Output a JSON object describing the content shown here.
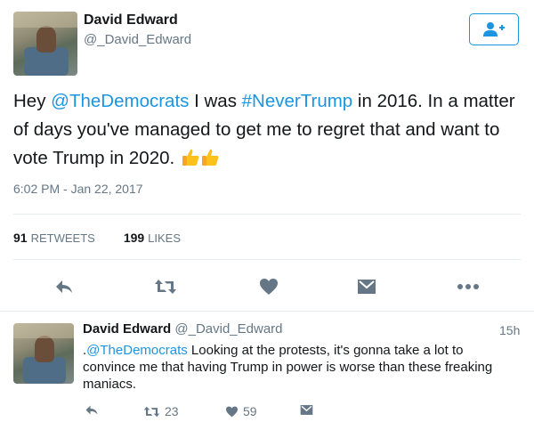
{
  "author": {
    "name": "David Edward",
    "handle": "@_David_Edward"
  },
  "tweet": {
    "text_before_mention": "Hey ",
    "mention": "@TheDemocrats",
    "text_middle": " I was ",
    "hashtag": "#NeverTrump",
    "text_after": " in 2016. In a matter of days you've managed to get me to regret that and want to vote Trump in 2020. ",
    "emoji": "👍👍",
    "timestamp": "6:02 PM - Jan 22, 2017"
  },
  "stats": {
    "retweets_count": "91",
    "retweets_label": "RETWEETS",
    "likes_count": "199",
    "likes_label": "LIKES"
  },
  "actions": {
    "icons": [
      "reply-icon",
      "retweet-icon",
      "like-icon",
      "direct-message-icon",
      "more-icon"
    ]
  },
  "reply": {
    "name": "David Edward",
    "handle": "@_David_Edward",
    "time": "15h",
    "prefix": ".",
    "mention": "@TheDemocrats",
    "text": " Looking at the protests, it's gonna take a lot to convince me that having Trump in power is worse than these freaking maniacs.",
    "retweet_count": "23",
    "like_count": "59"
  },
  "colors": {
    "accent": "#1b95e0",
    "muted": "#657786",
    "icon": "#657786"
  }
}
